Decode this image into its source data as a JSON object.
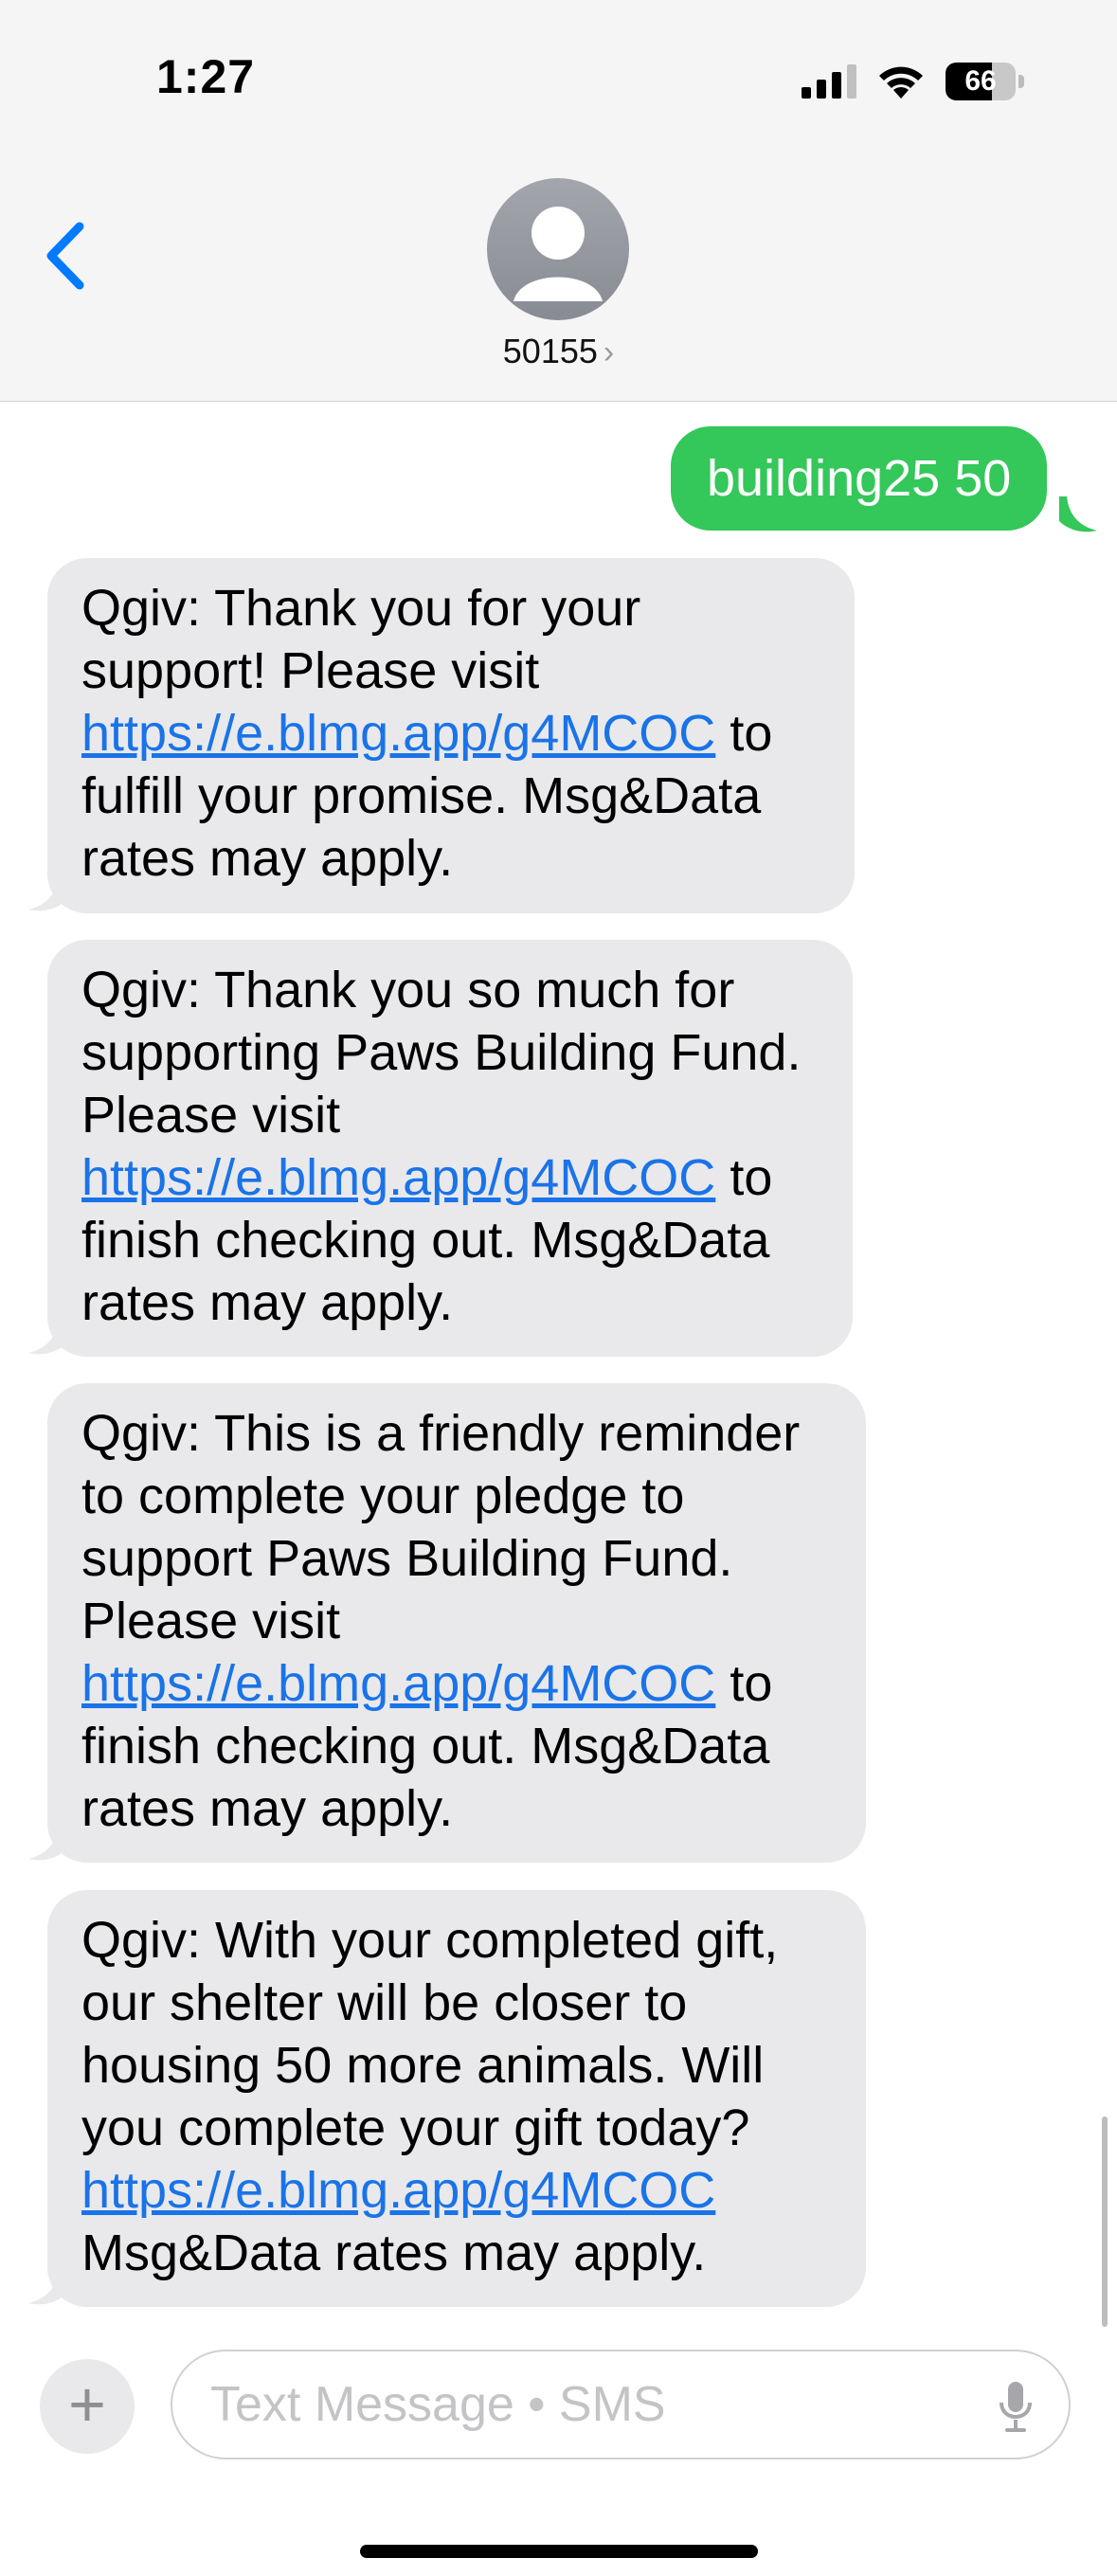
{
  "status_bar": {
    "time": "1:27",
    "battery": "66",
    "battery_level_percent": 66
  },
  "header": {
    "contact_name": "50155",
    "chevron": "›"
  },
  "messages": [
    {
      "direction": "outgoing",
      "text": "building25 50"
    },
    {
      "direction": "incoming",
      "before": "Qgiv: Thank you for your support! Please visit ",
      "link": "https://e.blmg.app/g4MCOC",
      "after": " to fulfill your promise. Msg&Data rates may apply."
    },
    {
      "direction": "incoming",
      "before": "Qgiv: Thank you so much for supporting Paws Building Fund. Please visit ",
      "link": "https://e.blmg.app/g4MCOC",
      "after": " to finish checking out. Msg&Data rates may apply."
    },
    {
      "direction": "incoming",
      "before": "Qgiv: This is a friendly reminder to complete your pledge to support Paws Building Fund. Please visit ",
      "link": "https://e.blmg.app/g4MCOC",
      "after": " to finish checking out. Msg&Data rates may apply."
    },
    {
      "direction": "incoming",
      "before": "Qgiv: With your completed gift, our shelter will be closer to housing 50 more animals. Will you complete your gift today? ",
      "link": "https://e.blmg.app/g4MCOC",
      "after": " Msg&Data rates may apply."
    }
  ],
  "composer": {
    "plus_label": "+",
    "placeholder": "Text Message • SMS"
  },
  "colors": {
    "outgoing": "#34c759",
    "incoming": "#e9e9eb",
    "link": "#1a73e8",
    "accent": "#007aff"
  },
  "icons": {
    "back": "chevron-left-icon",
    "avatar": "person-icon",
    "mic": "microphone-icon",
    "signal": "cellular-signal-icon",
    "wifi": "wifi-icon",
    "battery": "battery-icon"
  }
}
